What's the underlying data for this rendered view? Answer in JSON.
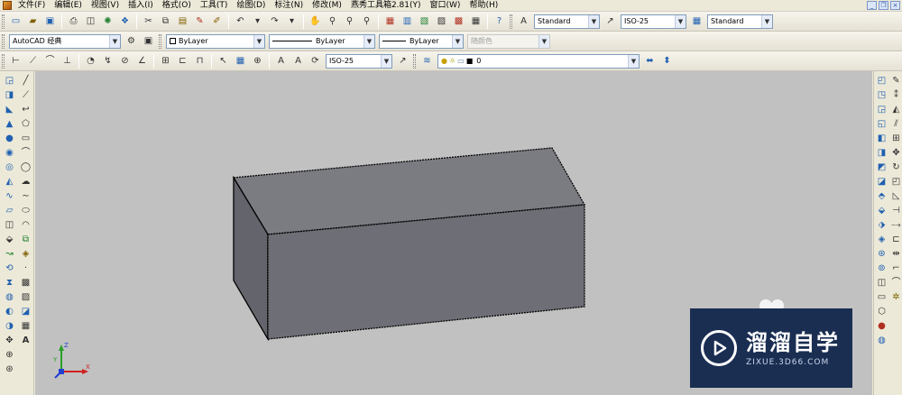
{
  "menubar": {
    "items": [
      "文件(F)",
      "编辑(E)",
      "视图(V)",
      "插入(I)",
      "格式(O)",
      "工具(T)",
      "绘图(D)",
      "标注(N)",
      "修改(M)",
      "燕秀工具箱2.81(Y)",
      "窗口(W)",
      "帮助(H)"
    ]
  },
  "styles_toolbar": {
    "text_style": "Standard",
    "dim_style": "ISO-25",
    "table_style": "Standard"
  },
  "workspace_toolbar": {
    "workspace": "AutoCAD 经典"
  },
  "properties_toolbar": {
    "color": "ByLayer",
    "linetype": "ByLayer",
    "lineweight": "ByLayer",
    "plot_style": "随颜色"
  },
  "dim_toolbar": {
    "dim_style": "ISO-25"
  },
  "layers_toolbar": {
    "current_layer": "0"
  },
  "ucs": {
    "x_label": "X",
    "y_label": "Y",
    "z_label": "Z"
  },
  "watermark": {
    "name": "溜溜自学",
    "url": "ZIXUE.3D66.COM"
  },
  "colors": {
    "canvas": "#c1c1c1",
    "box_top": "#7b7b82",
    "box_front": "#6e6e76",
    "box_side": "#64646c",
    "watermark_bg": "#1a2e52"
  }
}
